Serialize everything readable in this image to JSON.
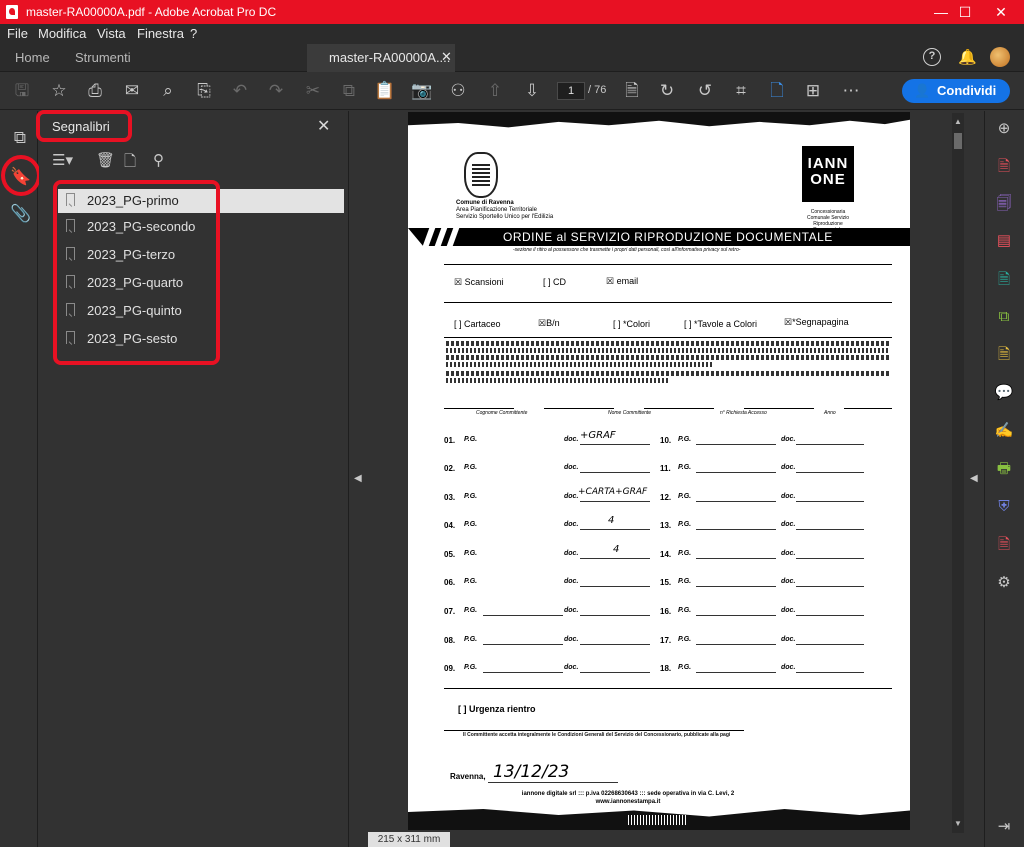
{
  "window": {
    "title": "master-RA00000A.pdf - Adobe Acrobat Pro DC"
  },
  "menu": [
    "File",
    "Modifica",
    "Vista",
    "Finestra",
    "?"
  ],
  "tabs": {
    "home": "Home",
    "tools": "Strumenti",
    "document": "master-RA00000A...."
  },
  "toolbar": {
    "page_current": "1",
    "page_total": "/ 76",
    "share_label": "Condividi"
  },
  "bookmarks": {
    "title": "Segnalibri",
    "items": [
      "2023_PG-primo",
      "2023_PG-secondo",
      "2023_PG-terzo",
      "2023_PG-quarto",
      "2023_PG-quinto",
      "2023_PG-sesto"
    ]
  },
  "document": {
    "city": "Comune di Ravenna",
    "city_sub1": "Area Pianificazione Territoriale",
    "city_sub2": "Servizio Sportello Unico per l'Edilizia",
    "logo_line1": "IANN",
    "logo_line2": "ONE",
    "logo_sub": "Concessionaria Comunale Servizio Riproduzione Documentale",
    "banner_title": "ORDINE al SERVIZIO RIPRODUZIONE DOCUMENTALE",
    "banner_sub": "-sezione il ritiro al possessore che trasmette i propri dati personali, così all'informativa privacy sul retro-",
    "opt_scan": "Scansioni",
    "opt_cd": "[ ]  CD",
    "opt_email": "email",
    "opt_cartaceo": "[ ]  Cartaceo",
    "opt_bn": "B/n",
    "opt_colori": "[ ]  *Colori",
    "opt_tavole": "[ ]  *Tavole a Colori",
    "opt_segnapagina": "*Segnapagina",
    "col_cognome": "Cognome Committente",
    "col_nome": "Nome Committente",
    "col_richiesta": "n° Richiesta Accesso",
    "col_anno": "Anno",
    "row_numbers": [
      "01.",
      "02.",
      "03.",
      "04.",
      "05.",
      "06.",
      "07.",
      "08.",
      "09.",
      "10.",
      "11.",
      "12.",
      "13.",
      "14.",
      "15.",
      "16.",
      "17.",
      "18."
    ],
    "pg_label": "P.G.",
    "doc_label": "doc.",
    "hand_01": "+GRAF",
    "hand_03": "+CARTA+GRAF",
    "hand_04": "4",
    "hand_05": "4",
    "urgenza": "[ ]  Urgenza rientro",
    "committente_note": "Il Committente accetta integralmente le Condizioni Generali del Servizio del Concessionario, pubblicate alla pagi",
    "ravenna": "Ravenna,",
    "date_hand": "13/12/23",
    "footer1": "iannone digitale srl ::: p.iva 02268630643 ::: sede operativa in via C. Levi, 2",
    "footer2": "www.iannonestampa.it"
  },
  "status": {
    "dimensions": "215 x 311 mm"
  },
  "icons": {
    "toolbar": [
      "save-icon",
      "star-icon",
      "print-icon",
      "mail-icon",
      "zoom-search-icon",
      "protect-icon",
      "undo-icon",
      "redo-icon",
      "cut-icon",
      "copy-icon",
      "clipboard-icon",
      "camera-icon",
      "binoculars-icon",
      "page-up-icon",
      "page-down-icon",
      "file-icon",
      "rotate-cw-icon",
      "rotate-ccw-icon",
      "crop-icon",
      "page-view-icon",
      "grid-icon",
      "more-icon"
    ],
    "right_rail": [
      "zoom-icon",
      "create-pdf-icon",
      "export-pdf-icon",
      "organize-pages-icon",
      "edit-pdf-icon",
      "combine-icon",
      "scan-icon",
      "comment-icon",
      "fill-sign-icon",
      "print-production-icon",
      "protect-icon",
      "acrobat-icon",
      "tools-icon"
    ]
  },
  "colors": {
    "title_bar": "#e81123",
    "accent": "#1473e6",
    "highlight_box": "#e81123"
  }
}
